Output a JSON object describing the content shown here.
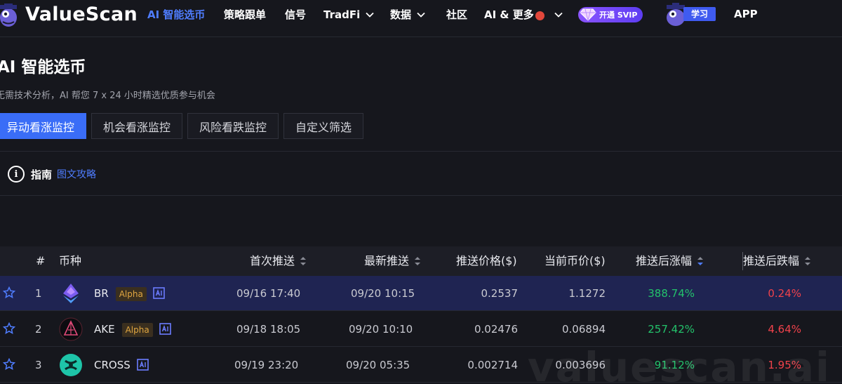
{
  "nav": {
    "brand": "ValueScan",
    "items": [
      {
        "label": "AI 智能选币",
        "active": true
      },
      {
        "label": "策略跟单"
      },
      {
        "label": "信号"
      },
      {
        "label": "TradFi",
        "dropdown": true
      },
      {
        "label": "数据",
        "dropdown": true
      },
      {
        "label": "社区"
      },
      {
        "label": "AI & 更多",
        "dropdown": true,
        "hot": true
      }
    ],
    "svip_label": "开通 SVIP",
    "learn_label": "学习",
    "app_label": "APP"
  },
  "page": {
    "title": "AI 智能选币",
    "subtitle": "无需技术分析，AI 帮您 7 x 24 小时精选优质参与机会"
  },
  "tabs": [
    {
      "label": "异动看涨监控",
      "active": true
    },
    {
      "label": "机会看涨监控"
    },
    {
      "label": "风险看跌监控"
    },
    {
      "label": "自定义筛选"
    }
  ],
  "guide": {
    "label": "指南",
    "link": "图文攻略"
  },
  "table": {
    "headers": {
      "index": "#",
      "coin": "币种",
      "first_push": "首次推送",
      "latest_push": "最新推送",
      "push_price": "推送价格($)",
      "current_price": "当前币价($)",
      "rise_after": "推送后涨幅",
      "fall_after": "推送后跌幅"
    },
    "rows": [
      {
        "index": "1",
        "coin": "BR",
        "alpha": "Alpha",
        "first_push": "09/16 17:40",
        "latest_push": "09/20 10:15",
        "push_price": "0.2537",
        "current_price": "1.1272",
        "rise_after": "388.74%",
        "fall_after": "0.24%"
      },
      {
        "index": "2",
        "coin": "AKE",
        "alpha": "Alpha",
        "first_push": "09/18 18:05",
        "latest_push": "09/20 10:10",
        "push_price": "0.02476",
        "current_price": "0.06894",
        "rise_after": "257.42%",
        "fall_after": "4.64%"
      },
      {
        "index": "3",
        "coin": "CROSS",
        "alpha": "",
        "first_push": "09/19 23:20",
        "latest_push": "09/20 05:35",
        "push_price": "0.002714",
        "current_price": "0.003696",
        "rise_after": "91.12%",
        "fall_after": "1.95%"
      }
    ]
  },
  "watermark": "valuescan.ai",
  "colors": {
    "accent": "#3a6df7",
    "up": "#23c26b",
    "down": "#f0424b",
    "alpha": "#e0a641"
  }
}
